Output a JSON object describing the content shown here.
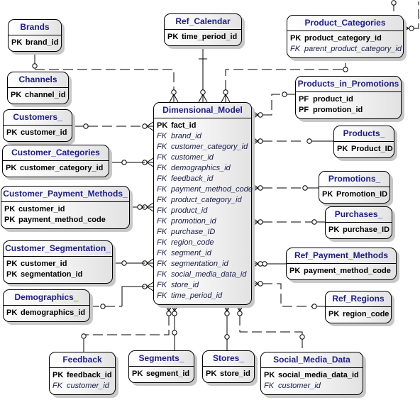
{
  "diagram_title": "Dimensional_Model",
  "entities": {
    "brands": {
      "name": "Brands",
      "attributes": [
        {
          "key": "PK",
          "name": "brand_id"
        }
      ]
    },
    "channels": {
      "name": "Channels",
      "attributes": [
        {
          "key": "PK",
          "name": "channel_id"
        }
      ]
    },
    "ref_calendar": {
      "name": "Ref_Calendar",
      "attributes": [
        {
          "key": "PK",
          "name": "time_period_id"
        }
      ]
    },
    "product_categories": {
      "name": "Product_Categories",
      "attributes": [
        {
          "key": "PK",
          "name": "product_category_id"
        },
        {
          "key": "FK",
          "name": "parent_product_category_id"
        }
      ]
    },
    "products_in_promotions": {
      "name": "Products_in_Promotions",
      "attributes": [
        {
          "key": "PF",
          "name": "product_id"
        },
        {
          "key": "PF",
          "name": "promotion_id"
        }
      ]
    },
    "customers": {
      "name": "Customers_",
      "attributes": [
        {
          "key": "PK",
          "name": "customer_id"
        }
      ]
    },
    "customer_categories": {
      "name": "Customer_Categories",
      "attributes": [
        {
          "key": "PK",
          "name": "customer_category_id"
        }
      ]
    },
    "customer_payment_methods": {
      "name": "Customer_Payment_Methods_",
      "attributes": [
        {
          "key": "PK",
          "name": "customer_id"
        },
        {
          "key": "PK",
          "name": "payment_method_code"
        }
      ]
    },
    "customer_segmentation": {
      "name": "Customer_Segmentation_",
      "attributes": [
        {
          "key": "PK",
          "name": "customer_id"
        },
        {
          "key": "PK",
          "name": "segmentation_id"
        }
      ]
    },
    "demographics": {
      "name": "Demographics_",
      "attributes": [
        {
          "key": "PK",
          "name": "demographics_id"
        }
      ]
    },
    "dimensional_model": {
      "name": "Dimensional_Model",
      "attributes": [
        {
          "key": "PK",
          "name": "fact_id"
        },
        {
          "key": "FK",
          "name": "brand_id"
        },
        {
          "key": "FK",
          "name": "customer_category_id"
        },
        {
          "key": "FK",
          "name": "customer_id"
        },
        {
          "key": "FK",
          "name": "demographics_id"
        },
        {
          "key": "FK",
          "name": "feedback_id"
        },
        {
          "key": "FK",
          "name": "payment_method_code"
        },
        {
          "key": "FK",
          "name": "product_category_id"
        },
        {
          "key": "FK",
          "name": "product_id"
        },
        {
          "key": "FK",
          "name": "promotion_id"
        },
        {
          "key": "FK",
          "name": "purchase_ID"
        },
        {
          "key": "FK",
          "name": "region_code"
        },
        {
          "key": "FK",
          "name": "segment_id"
        },
        {
          "key": "FK",
          "name": "segmentation_id"
        },
        {
          "key": "FK",
          "name": "social_media_data_id"
        },
        {
          "key": "FK",
          "name": "store_id"
        },
        {
          "key": "FK",
          "name": "time_period_id"
        }
      ]
    },
    "products": {
      "name": "Products_",
      "attributes": [
        {
          "key": "PK",
          "name": "Product_ID"
        }
      ]
    },
    "promotions": {
      "name": "Promotions_",
      "attributes": [
        {
          "key": "PK",
          "name": "Promotion_ID"
        }
      ]
    },
    "purchases": {
      "name": "Purchases_",
      "attributes": [
        {
          "key": "PK",
          "name": "purchase_ID"
        }
      ]
    },
    "ref_payment_methods": {
      "name": "Ref_Payment_Methods",
      "attributes": [
        {
          "key": "PK",
          "name": "payment_method_code"
        }
      ]
    },
    "ref_regions": {
      "name": "Ref_Regions",
      "attributes": [
        {
          "key": "PK",
          "name": "region_code"
        }
      ]
    },
    "feedback": {
      "name": "Feedback",
      "attributes": [
        {
          "key": "PK",
          "name": "feedback_id"
        },
        {
          "key": "FK",
          "name": "customer_id"
        }
      ]
    },
    "segments": {
      "name": "Segments_",
      "attributes": [
        {
          "key": "PK",
          "name": "segment_id"
        }
      ]
    },
    "stores": {
      "name": "Stores_",
      "attributes": [
        {
          "key": "PK",
          "name": "store_id"
        }
      ]
    },
    "social_media_data": {
      "name": "Social_Media_Data",
      "attributes": [
        {
          "key": "PK",
          "name": "social_media_data_id"
        },
        {
          "key": "FK",
          "name": "customer_id"
        }
      ]
    }
  },
  "relationships": [
    {
      "from": "brands",
      "to": "dimensional_model",
      "style": "dashed"
    },
    {
      "from": "channels",
      "to": "dimensional_model",
      "style": "dashed"
    },
    {
      "from": "ref_calendar",
      "to": "dimensional_model",
      "style": "solid-identifying"
    },
    {
      "from": "product_categories",
      "to": "dimensional_model",
      "style": "dashed"
    },
    {
      "from": "product_categories",
      "to": "product_categories",
      "style": "dashed-self"
    },
    {
      "from": "products_in_promotions",
      "to": "dimensional_model",
      "style": "dashed"
    },
    {
      "from": "customers",
      "to": "dimensional_model",
      "style": "dashed"
    },
    {
      "from": "customer_categories",
      "to": "dimensional_model",
      "style": "solid"
    },
    {
      "from": "customer_payment_methods",
      "to": "dimensional_model",
      "style": "solid"
    },
    {
      "from": "customer_segmentation",
      "to": "dimensional_model",
      "style": "solid"
    },
    {
      "from": "demographics",
      "to": "dimensional_model",
      "style": "dashed"
    },
    {
      "from": "products",
      "to": "dimensional_model",
      "style": "dashed"
    },
    {
      "from": "promotions",
      "to": "dimensional_model",
      "style": "dashed"
    },
    {
      "from": "purchases",
      "to": "dimensional_model",
      "style": "dashed"
    },
    {
      "from": "ref_payment_methods",
      "to": "dimensional_model",
      "style": "solid"
    },
    {
      "from": "ref_regions",
      "to": "dimensional_model",
      "style": "dashed"
    },
    {
      "from": "feedback",
      "to": "dimensional_model",
      "style": "dashed"
    },
    {
      "from": "segments",
      "to": "dimensional_model",
      "style": "solid"
    },
    {
      "from": "stores",
      "to": "dimensional_model",
      "style": "solid"
    },
    {
      "from": "social_media_data",
      "to": "dimensional_model",
      "style": "dashed"
    }
  ]
}
